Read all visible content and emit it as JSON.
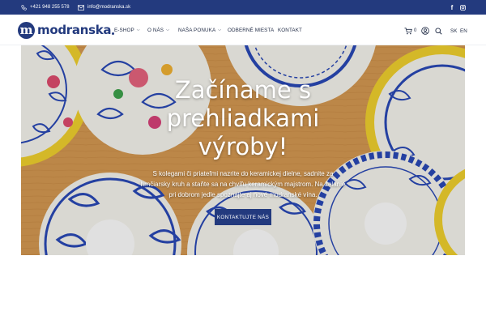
{
  "topbar": {
    "phone": "+421 948 255 578",
    "email": "info@modranska.sk",
    "social": [
      {
        "name": "facebook-icon",
        "glyph": "f"
      },
      {
        "name": "instagram-icon",
        "glyph": "◎"
      }
    ]
  },
  "header": {
    "logo": {
      "badge": "m",
      "word": "modranska"
    },
    "nav": [
      {
        "label": "E-SHOP",
        "has_dropdown": true
      },
      {
        "label": "O NÁS",
        "has_dropdown": true
      },
      {
        "label": "NAŠA PONUKA",
        "has_dropdown": true
      },
      {
        "label": "ODBERNÉ MIESTA",
        "has_dropdown": false
      },
      {
        "label": "KONTAKT",
        "has_dropdown": false
      }
    ],
    "cart_count": "0",
    "languages": [
      "SK",
      "EN"
    ]
  },
  "hero": {
    "title": "Začíname s\nprehliadkami\nvýroby!",
    "text": "S kolegami či priateľmi nazrite do keramickej dielne, sadnite za hrnčiarsky kruh a staňte sa na chvíľu keramickým majstrom. Na želanie pri dobrom jedle spoznajte aj nové modranské vína.",
    "cta_label": "KONTAKTUJTE NÁS"
  },
  "colors": {
    "brand": "#233a7e",
    "white": "#ffffff",
    "plate_yellow": "#f2d22e",
    "plate_blue": "#2a49b8",
    "table_wood": "#d99d52"
  }
}
